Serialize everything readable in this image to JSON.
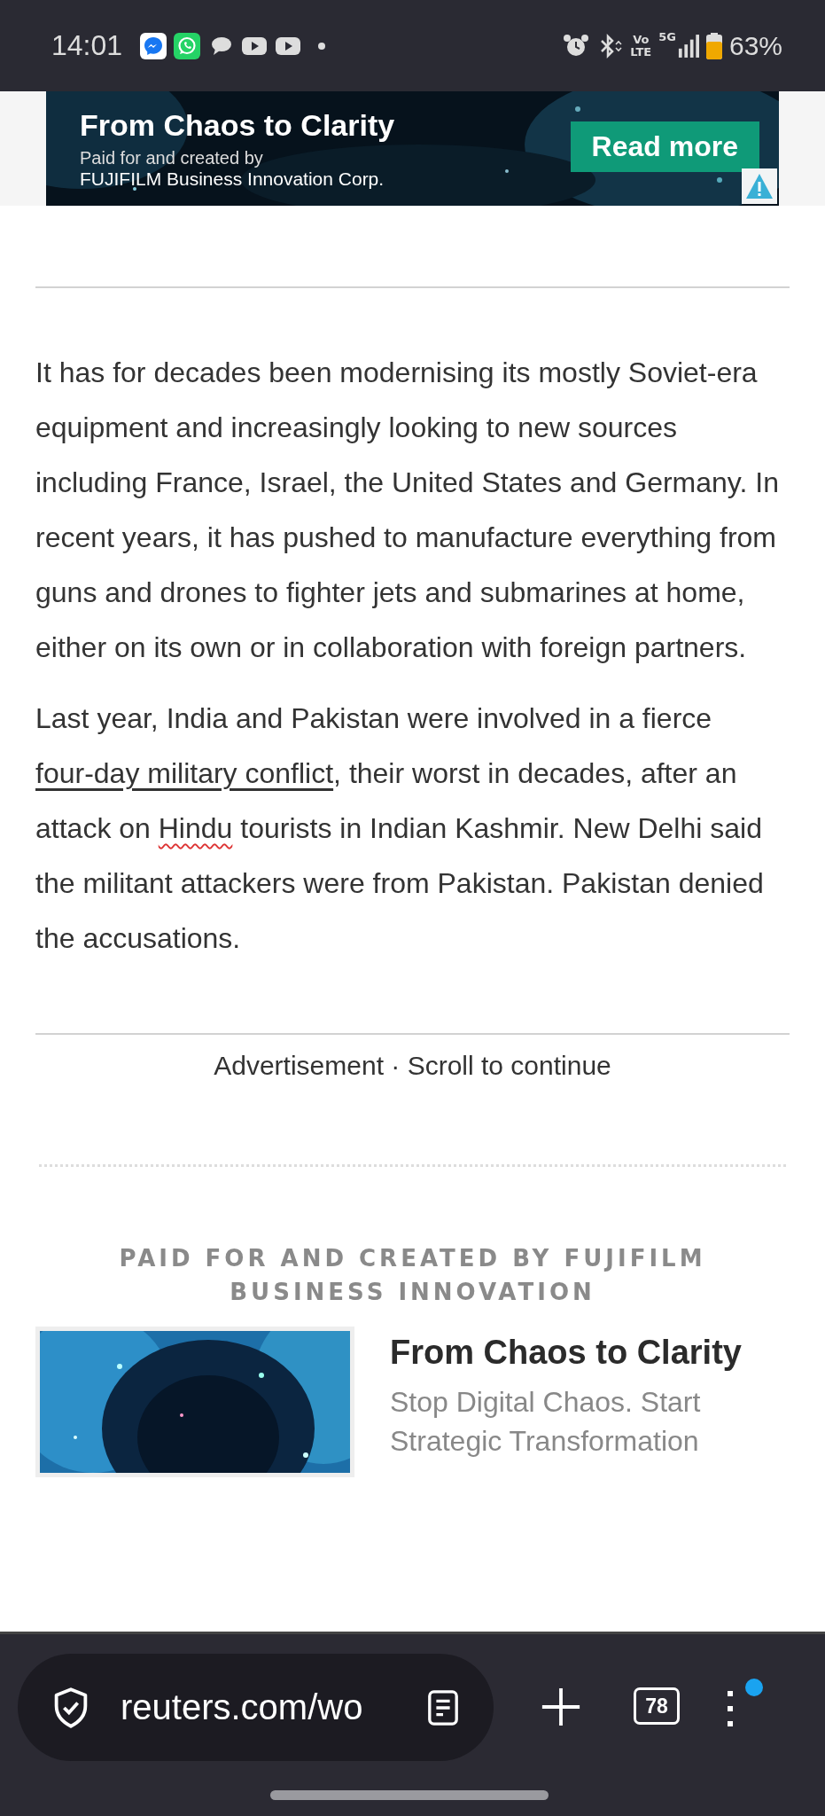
{
  "status_bar": {
    "time": "14:01",
    "battery": "63%",
    "network": "5G",
    "volte": [
      "Vo",
      "LTE"
    ]
  },
  "top_ad": {
    "title": "From Chaos to Clarity",
    "line_1": "Paid for and created by",
    "line_2": "FUJIFILM Business Innovation Corp.",
    "button": "Read more"
  },
  "article": {
    "paragraphs": [
      [
        {
          "kind": "text",
          "text": "It has for decades been modernising its mostly Soviet-era equipment and increasingly looking to new sources including France, Israel, the United States and Germany. In recent years, it has pushed to manufacture everything from guns and drones to fighter jets and submarines at home, either on its own or in collaboration with foreign partners."
        }
      ],
      [
        {
          "kind": "text",
          "text": "Last year, India and Pakistan were involved in a fierce "
        },
        {
          "kind": "link",
          "text": "four-day military conflict"
        },
        {
          "kind": "text",
          "text": ", their worst in decades, after an attack on "
        },
        {
          "kind": "flagged",
          "text": "Hindu"
        },
        {
          "kind": "text",
          "text": " tourists in Indian Kashmir. New Delhi said the militant attackers were from Pakistan. Pakistan denied the accusations."
        }
      ]
    ]
  },
  "ad_notice": "Advertisement · Scroll to continue",
  "sponsored": {
    "label": "PAID FOR AND CREATED BY FUJIFILM BUSINESS INNOVATION",
    "title": "From Chaos to Clarity",
    "description": "Stop Digital Chaos. Start Strategic Transformation"
  },
  "browser_bar": {
    "url": "reuters.com/wo",
    "tab_count": "78",
    "menu_badge": true
  }
}
